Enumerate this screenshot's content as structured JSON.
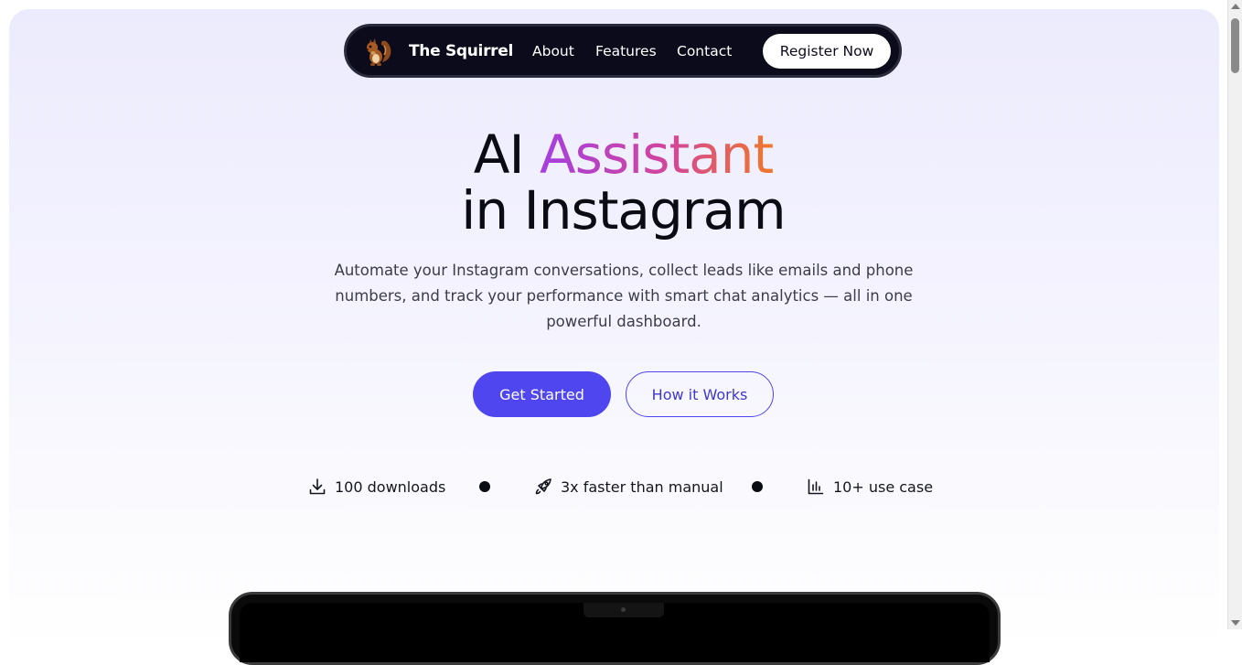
{
  "nav": {
    "brand": "The Squirrel",
    "logo_icon": "squirrel-icon",
    "links": [
      "About",
      "Features",
      "Contact"
    ],
    "cta": "Register Now"
  },
  "hero": {
    "title_plain": "AI",
    "title_highlight": "Assistant",
    "title_line2": "in Instagram",
    "subtitle": "Automate your Instagram conversations, collect leads like emails and phone numbers, and track your performance with smart chat analytics — all in one powerful dashboard.",
    "primary_button": "Get Started",
    "secondary_button": "How it Works"
  },
  "stats": [
    {
      "icon": "download-icon",
      "text": "100 downloads"
    },
    {
      "icon": "rocket-icon",
      "text": "3x faster than manual"
    },
    {
      "icon": "bar-chart-icon",
      "text": "10+ use case"
    }
  ],
  "colors": {
    "primary": "#4f46f0",
    "nav_bg": "#0b0b1c",
    "gradient_start": "#a53fe0",
    "gradient_end": "#f0782a"
  }
}
